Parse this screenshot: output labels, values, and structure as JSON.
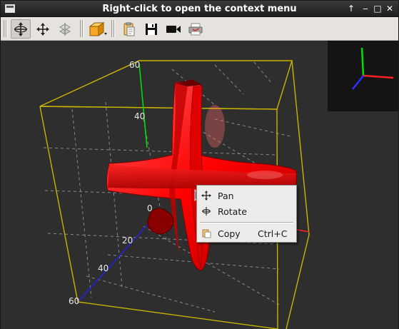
{
  "window": {
    "title": "Right-click to open the context menu",
    "buttons": [
      {
        "icon": "arrow-up-icon",
        "glyph": "↑"
      },
      {
        "icon": "minimize-icon",
        "glyph": "‒"
      },
      {
        "icon": "maximize-icon",
        "glyph": "□"
      },
      {
        "icon": "close-icon",
        "glyph": "✕"
      }
    ]
  },
  "toolbar": {
    "tools": [
      {
        "name": "rotate-mode-icon",
        "active": true
      },
      {
        "name": "pan-mode-icon",
        "active": false
      },
      {
        "name": "zoom-mode-icon",
        "active": false
      },
      {
        "name": "view-cube-icon",
        "active": false
      },
      {
        "name": "copy-image-icon",
        "active": false
      },
      {
        "name": "save-icon",
        "active": false
      },
      {
        "name": "record-video-icon",
        "active": false
      },
      {
        "name": "print-icon",
        "active": false
      }
    ]
  },
  "scene": {
    "axis_ticks": [
      {
        "label": "60",
        "axis": "z"
      },
      {
        "label": "40",
        "axis": "z"
      },
      {
        "label": "0",
        "axis": "origin"
      },
      {
        "label": "20",
        "axis": "x"
      },
      {
        "label": "40",
        "axis": "x"
      },
      {
        "label": "60",
        "axis": "x"
      }
    ],
    "colors": {
      "surface": "#ff0000",
      "bounding_box": "#c8b400",
      "grid": "#8a8a8a",
      "x_axis": "#2222dd",
      "y_axis": "#ff2222",
      "z_axis": "#00dd00",
      "background": "#2e2e2e"
    }
  },
  "context_menu": {
    "items": [
      {
        "label": "Pan",
        "shortcut": "",
        "icon": "pan-icon"
      },
      {
        "label": "Rotate",
        "shortcut": "",
        "icon": "rotate-icon"
      },
      {
        "label": "Copy",
        "shortcut": "Ctrl+C",
        "icon": "copy-icon"
      }
    ]
  }
}
